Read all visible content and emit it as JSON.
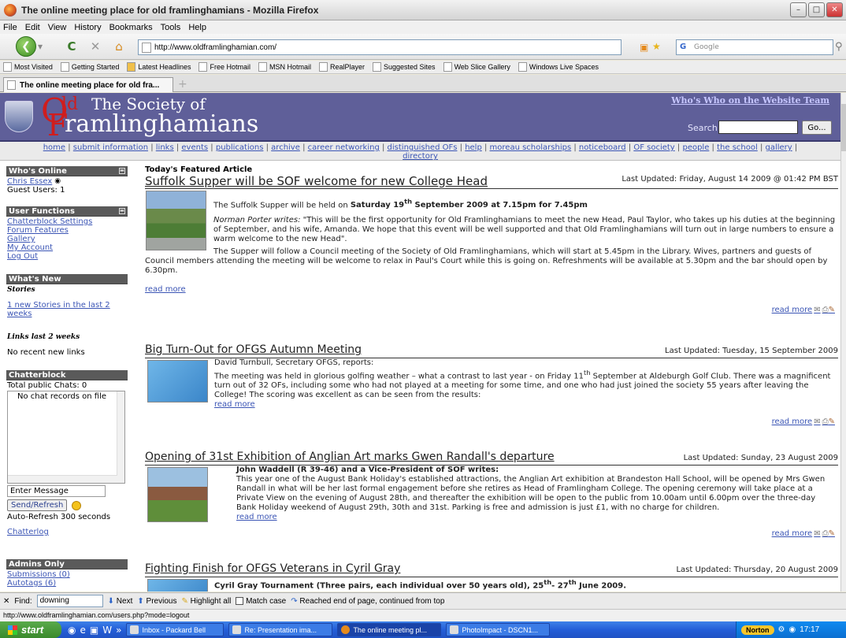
{
  "window": {
    "title": "The online meeting place for old framlinghamians - Mozilla Firefox"
  },
  "menu": [
    "File",
    "Edit",
    "View",
    "History",
    "Bookmarks",
    "Tools",
    "Help"
  ],
  "url": "http://www.oldframlinghamian.com/",
  "search_placeholder": "Google",
  "bookmarks": [
    "Most Visited",
    "Getting Started",
    "Latest Headlines",
    "Free Hotmail",
    "MSN Hotmail",
    "RealPlayer",
    "Suggested Sites",
    "Web Slice Gallery",
    "Windows Live Spaces"
  ],
  "tab": {
    "label": "The online meeting place for old fra...",
    "new": "+"
  },
  "site": {
    "logo_o": "O",
    "logo_ld": "ld",
    "logo_line1": "The Society of",
    "logo_f": "F",
    "logo_line2": "ramlinghamians",
    "whos_who": "Who's Who on the Website Team",
    "search_label": "Search",
    "go": "Go..."
  },
  "nav": [
    "home",
    "submit information",
    "links",
    "events",
    "publications",
    "archive",
    "career networking",
    "distinguished OFs",
    "help",
    "moreau scholarships",
    "noticeboard",
    "OF society",
    "people",
    "the school",
    "gallery",
    "directory"
  ],
  "sidebar": {
    "whos_online": {
      "title": "Who's Online",
      "user": "Chris Essex",
      "guests": "Guest Users: 1"
    },
    "user_functions": {
      "title": "User Functions",
      "links": [
        "Chatterblock Settings",
        "Forum Features",
        "Gallery",
        "My Account",
        "Log Out"
      ]
    },
    "whats_new": {
      "title": "What's New",
      "stories_label": "Stories",
      "stories_link": "1 new Stories in the last 2 weeks",
      "links_label": "Links last 2 weeks",
      "links_text": "No recent new links"
    },
    "chatterblock": {
      "title": "Chatterblock",
      "total": "Total public Chats: 0",
      "records": "No chat records on file",
      "enter": "Enter Message",
      "send": "Send/Refresh",
      "auto": "Auto-Refresh 300 seconds",
      "log": "Chatterlog"
    },
    "admins": {
      "title": "Admins Only",
      "submissions": "Submissions (0)",
      "autotags": "Autotags (6)"
    }
  },
  "featured_label": "Today's Featured Article",
  "articles": [
    {
      "title": "Suffolk Supper will be SOF welcome for new College Head",
      "updated": "Last Updated: Friday, August 14 2009 @ 01:42 PM BST",
      "p0a": "The Suffolk Supper will be held on ",
      "p0b": "Saturday 19",
      "p0sup": "th",
      "p0c": " September 2009 at 7.15pm for 7.45pm",
      "p1a": "Norman Porter writes:",
      "p1b": " \"This will be the first opportunity for Old Framlinghamians to meet the new Head, Paul Taylor, who takes up his duties at the beginning of September, and his wife, Amanda.  We hope that this event will be well supported and that Old Framlinghamians will turn out in large numbers to ensure a warm welcome to the new Head\".",
      "p2": "The Supper will follow a Council meeting of the Society of Old Framlinghamians, which will start at 5.45pm in the Library.  Wives, partners and guests of Council members attending the meeting will be welcome to relax in Paul's Court while this is going on.  Refreshments will be available at 5.30pm and the bar should open by 6.30pm.",
      "read_more": "read more"
    },
    {
      "title": "Big Turn-Out for OFGS Autumn Meeting",
      "updated": "Last Updated: Tuesday, 15 September 2009",
      "byline": "David Turnbull, Secretary OFGS, reports:",
      "p1a": "The meeting was held in glorious golfing weather – what a contrast to last year - on Friday 11",
      "p1sup": "th",
      "p1b": " September at Aldeburgh Golf Club. There was a magnificent turn out of 32 OFs, including some who had not played at a meeting for some time, and one who had just joined the society 55 years after leaving the College! The scoring was excellent as can be seen from the results:",
      "read_more": "read more"
    },
    {
      "title": "Opening of 31st Exhibition of Anglian Art marks Gwen Randall's departure",
      "updated": "Last Updated: Sunday, 23 August 2009",
      "byline": "John Waddell (R 39-46) and a Vice-President of SOF writes:",
      "p1": "This year one of the August Bank Holiday's established attractions, the Anglian Art exhibition at Brandeston Hall School, will be opened by Mrs Gwen Randall in what will be her last formal engagement before she retires as Head of Framlingham College. The opening ceremony will take place at a Private View on the evening of August 28th, and thereafter the exhibition will be open to the public from 10.00am until 6.00pm over the three-day Bank Holiday weekend of August 29th, 30th and 31st. Parking is free and admission is just £1, with no charge for children.",
      "read_more": "read more"
    },
    {
      "title": "Fighting Finish for OFGS Veterans in Cyril Gray",
      "updated": "Last Updated: Thursday, 20 August 2009",
      "byline_a": "Cyril Gray Tournament (Three pairs, each individual over 50 years old), 25",
      "byline_sup1": "th",
      "byline_b": "- 27",
      "byline_sup2": "th",
      "byline_c": " June 2009."
    }
  ],
  "read_more_action": "read more",
  "findbar": {
    "label": "Find:",
    "value": "downing",
    "next": "Next",
    "previous": "Previous",
    "highlight": "Highlight all",
    "match": "Match case",
    "status": "Reached end of page, continued from top"
  },
  "status_url": "http://www.oldframlinghamian.com/users.php?mode=logout",
  "taskbar": {
    "start": "start",
    "items": [
      "Inbox - Packard Bell",
      "Re: Presentation ima...",
      "The online meeting pl...",
      "PhotoImpact - DSCN1..."
    ],
    "norton": "Norton",
    "clock": "17:17"
  },
  "colors": {
    "header_bg": "#5f5f99",
    "logo_red": "#d01d1d",
    "link": "#3b55b5",
    "sidebar_head": "#5a5a5a"
  }
}
